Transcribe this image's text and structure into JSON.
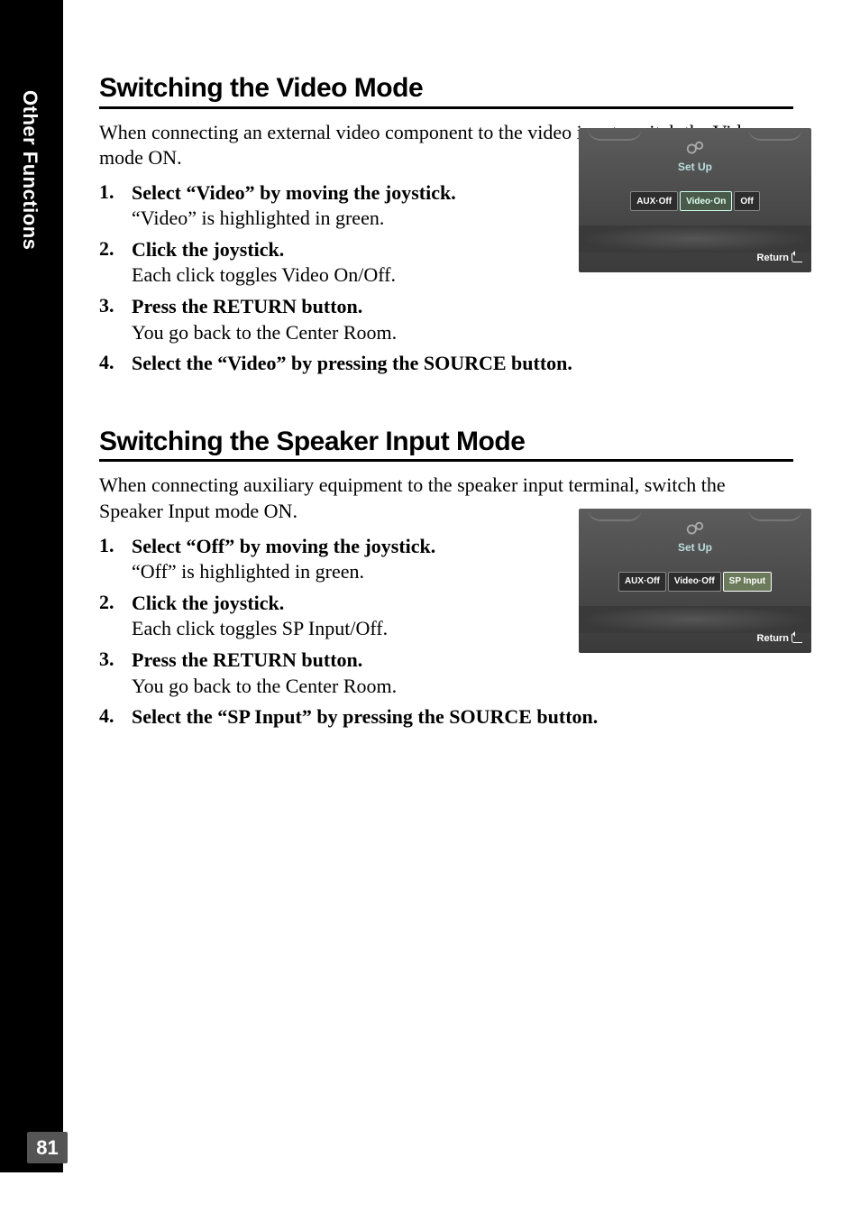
{
  "sidebar": {
    "label": "Other Functions"
  },
  "page_number": "81",
  "section1": {
    "title": "Switching the Video Mode",
    "intro": "When connecting an external video component to the video input, switch the Video mode ON.",
    "steps": [
      {
        "num": "1.",
        "head": "Select “Video” by moving the joystick.",
        "desc": "“Video” is highlighted in green."
      },
      {
        "num": "2.",
        "head": "Click the joystick.",
        "desc": "Each click toggles Video On/Off."
      },
      {
        "num": "3.",
        "head": "Press the RETURN button.",
        "desc": "You go back to the Center Room."
      },
      {
        "num": "4.",
        "head": "Select the “Video” by pressing the SOURCE button.",
        "desc": ""
      }
    ],
    "screenshot": {
      "title": "Set Up",
      "chips": [
        "AUX·Off",
        "Video·On",
        "Off"
      ],
      "selected_index": 1,
      "return_label": "Return"
    }
  },
  "section2": {
    "title": "Switching the Speaker Input Mode",
    "intro": "When connecting auxiliary equipment to the speaker input terminal, switch the Speaker Input mode ON.",
    "steps": [
      {
        "num": "1.",
        "head": "Select “Off” by moving the joystick.",
        "desc": "“Off” is highlighted in green."
      },
      {
        "num": "2.",
        "head": "Click the joystick.",
        "desc": "Each click toggles SP Input/Off."
      },
      {
        "num": "3.",
        "head": "Press the RETURN button.",
        "desc": "You go back to the Center Room."
      },
      {
        "num": "4.",
        "head": "Select the “SP Input” by pressing the SOURCE button.",
        "desc": ""
      }
    ],
    "screenshot": {
      "title": "Set Up",
      "chips": [
        "AUX·Off",
        "Video·Off",
        "SP Input"
      ],
      "selected_index": 2,
      "return_label": "Return"
    }
  }
}
